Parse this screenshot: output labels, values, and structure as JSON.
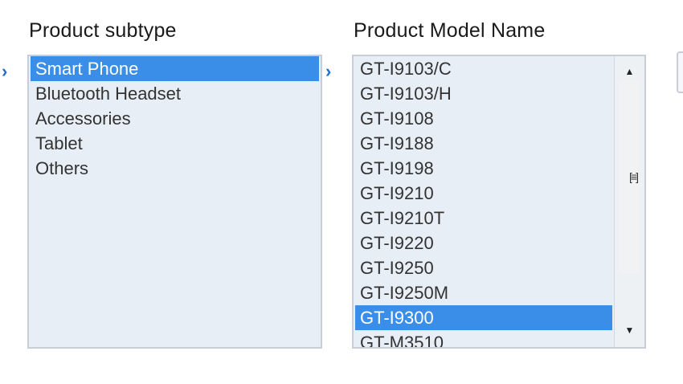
{
  "subtype": {
    "label": "Product subtype",
    "options": [
      {
        "label": "Smart Phone",
        "selected": true
      },
      {
        "label": "Bluetooth Headset",
        "selected": false
      },
      {
        "label": "Accessories",
        "selected": false
      },
      {
        "label": "Tablet",
        "selected": false
      },
      {
        "label": "Others",
        "selected": false
      }
    ]
  },
  "model": {
    "label": "Product Model Name",
    "options": [
      {
        "label": "GT-I9103/C",
        "selected": false
      },
      {
        "label": "GT-I9103/H",
        "selected": false
      },
      {
        "label": "GT-I9108",
        "selected": false
      },
      {
        "label": "GT-I9188",
        "selected": false
      },
      {
        "label": "GT-I9198",
        "selected": false
      },
      {
        "label": "GT-I9210",
        "selected": false
      },
      {
        "label": "GT-I9210T",
        "selected": false
      },
      {
        "label": "GT-I9220",
        "selected": false
      },
      {
        "label": "GT-I9250",
        "selected": false
      },
      {
        "label": "GT-I9250M",
        "selected": false
      },
      {
        "label": "GT-I9300",
        "selected": true
      },
      {
        "label": "GT-M3510",
        "selected": false
      }
    ]
  },
  "icons": {
    "arrow": "›",
    "scroll_up": "▲",
    "scroll_down": "▼",
    "grip": "[≡]"
  },
  "colors": {
    "selection": "#3b8ee8",
    "arrow": "#1f6fc7",
    "list_background": "#e8eef5"
  }
}
